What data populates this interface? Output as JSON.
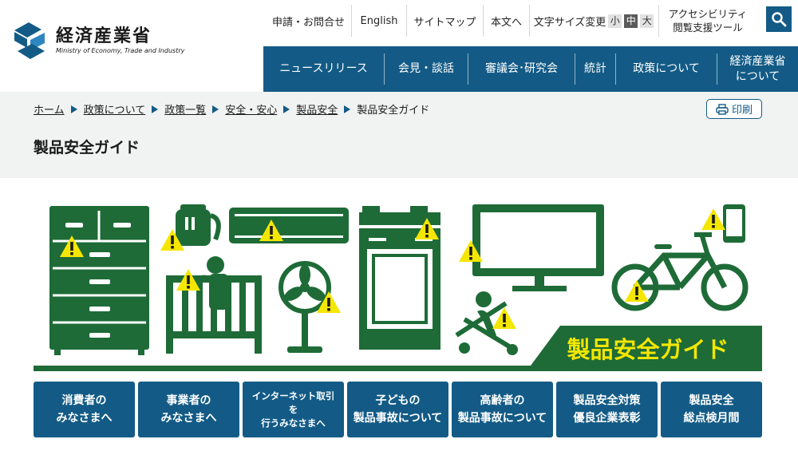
{
  "header": {
    "logo_jp": "経済産業省",
    "logo_en": "Ministry of Economy, Trade and Industry",
    "util": {
      "apply": "申請・お問合せ",
      "english": "English",
      "sitemap": "サイトマップ",
      "to_body": "本文へ",
      "font_size_label": "文字サイズ変更",
      "font_small": "小",
      "font_medium": "中",
      "font_large": "大",
      "a11y_line1": "アクセシビリティ",
      "a11y_line2": "閲覧支援ツール"
    }
  },
  "gnav": [
    {
      "line1": "ニュースリリース",
      "line2": ""
    },
    {
      "line1": "会見・談話",
      "line2": ""
    },
    {
      "line1": "審議会･研究会",
      "line2": ""
    },
    {
      "line1": "統計",
      "line2": ""
    },
    {
      "line1": "政策について",
      "line2": ""
    },
    {
      "line1": "経済産業省",
      "line2": "について"
    }
  ],
  "breadcrumb": [
    {
      "label": "ホーム"
    },
    {
      "label": "政策について"
    },
    {
      "label": "政策一覧"
    },
    {
      "label": "安全・安心"
    },
    {
      "label": "製品安全"
    }
  ],
  "breadcrumb_current": "製品安全ガイド",
  "print_label": "印刷",
  "page_title": "製品安全ガイド",
  "hero": {
    "banner_text": "製品安全ガイド",
    "colors": {
      "green": "#1e6b37",
      "warning_yellow": "#f5e600",
      "banner_yellow": "#f3e600"
    }
  },
  "tiles": [
    {
      "text": "消費者の\nみなさまへ"
    },
    {
      "text": "事業者の\nみなさまへ"
    },
    {
      "text": "インターネット取引\nを\n行うみなさまへ"
    },
    {
      "text": "子どもの\n製品事故について"
    },
    {
      "text": "高齢者の\n製品事故について"
    },
    {
      "text": "製品安全対策\n優良企業表彰"
    },
    {
      "text": "製品安全\n総点検月間"
    }
  ],
  "colors": {
    "brand_blue": "#135b86",
    "band_gray": "#f1f2f2"
  }
}
